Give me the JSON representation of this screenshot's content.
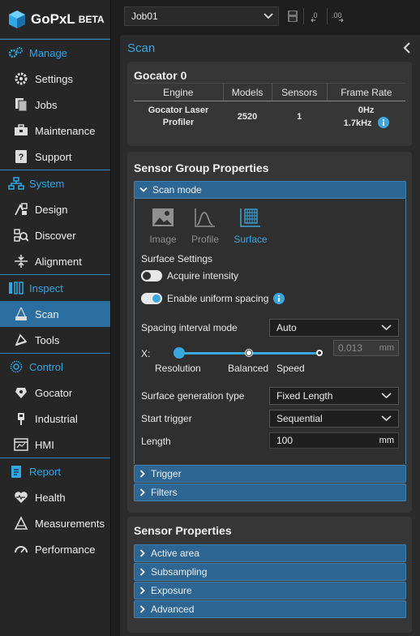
{
  "app": {
    "logo_text": "GoPxL",
    "logo_badge": "BETA"
  },
  "sidebar": {
    "sections": [
      {
        "title": "Manage",
        "items": [
          "Settings",
          "Jobs",
          "Maintenance",
          "Support"
        ]
      },
      {
        "title": "System",
        "items": [
          "Design",
          "Discover",
          "Alignment"
        ]
      },
      {
        "title": "Inspect",
        "items": [
          "Scan",
          "Tools"
        ]
      },
      {
        "title": "Control",
        "items": [
          "Gocator",
          "Industrial",
          "HMI"
        ]
      },
      {
        "title": "Report",
        "items": [
          "Health",
          "Measurements",
          "Performance"
        ]
      }
    ],
    "active_item": "Scan"
  },
  "topbar": {
    "job_value": "Job01"
  },
  "main": {
    "title": "Scan"
  },
  "gocator": {
    "title": "Gocator 0",
    "headers": [
      "Engine",
      "Models",
      "Sensors",
      "Frame Rate"
    ],
    "engine": "Gocator Laser Profiler",
    "models": "2520",
    "sensors": "1",
    "frame_rate": "0Hz",
    "frame_rate_max": "1.7kHz"
  },
  "sensor_group": {
    "title": "Sensor Group Properties",
    "scan_mode_label": "Scan mode",
    "modes": [
      "Image",
      "Profile",
      "Surface"
    ],
    "selected_mode": "Surface",
    "surface_settings_label": "Surface Settings",
    "acquire_intensity": {
      "label": "Acquire intensity",
      "on": false
    },
    "uniform_spacing": {
      "label": "Enable uniform spacing",
      "on": true
    },
    "spacing_mode": {
      "label": "Spacing interval mode",
      "value": "Auto"
    },
    "slider": {
      "axis": "X:",
      "stops": [
        "Resolution",
        "Balanced",
        "Speed"
      ],
      "value": "0.013",
      "unit": "mm"
    },
    "surface_gen": {
      "label": "Surface generation type",
      "value": "Fixed Length"
    },
    "start_trigger": {
      "label": "Start trigger",
      "value": "Sequential"
    },
    "length": {
      "label": "Length",
      "value": "100",
      "unit": "mm"
    },
    "trigger_label": "Trigger",
    "filters_label": "Filters"
  },
  "sensor_props": {
    "title": "Sensor Properties",
    "sections": [
      "Active area",
      "Subsampling",
      "Exposure",
      "Advanced"
    ]
  },
  "colors": {
    "accent": "#3aa7e0",
    "active_nav": "#2b6fa0",
    "accordion": "#2d6692"
  }
}
